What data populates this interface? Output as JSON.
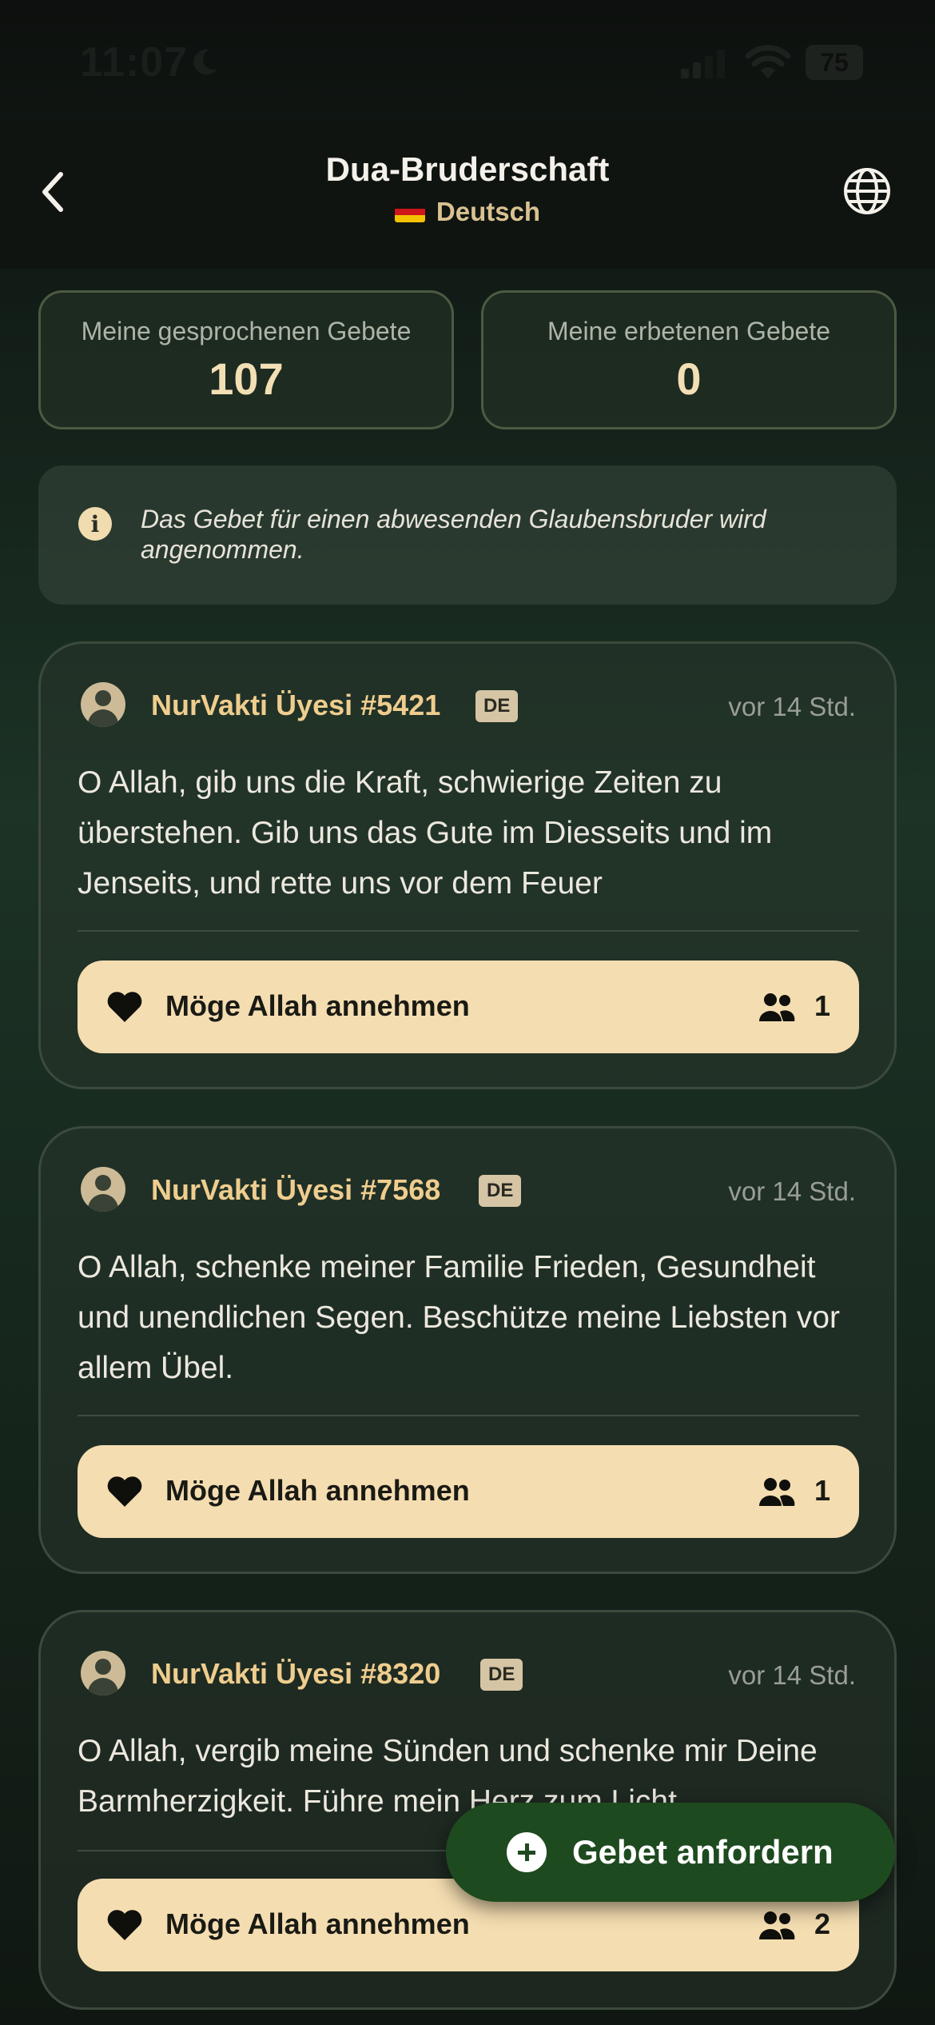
{
  "status_bar": {
    "time": "11:07",
    "battery": "75",
    "icons": [
      "moon-icon",
      "signal-icon",
      "wifi-icon",
      "battery-icon"
    ]
  },
  "header": {
    "title": "Dua-Bruderschaft",
    "language": "Deutsch",
    "icons": [
      "back-chevron-icon",
      "globe-icon",
      "german-flag-icon"
    ]
  },
  "stats": {
    "spoken": {
      "label": "Meine gesprochenen Gebete",
      "value": "107"
    },
    "requested": {
      "label": "Meine erbetenen Gebete",
      "value": "0"
    }
  },
  "info": {
    "icon": "info-icon",
    "text": "Das Gebet für einen abwesenden Glaubensbruder wird angenommen."
  },
  "posts": [
    {
      "user": "NurVakti Üyesi #5421",
      "lang_badge": "DE",
      "time": "vor 14 Std.",
      "text": "O Allah, gib uns die Kraft, schwierige Zeiten zu überstehen. Gib uns das Gute im Diesseits und im Jenseits, und rette uns vor dem Feuer",
      "button_label": "Möge Allah annehmen",
      "count": "1"
    },
    {
      "user": "NurVakti Üyesi #7568",
      "lang_badge": "DE",
      "time": "vor 14 Std.",
      "text": "O Allah, schenke meiner Familie Frieden, Gesundheit und unendlichen Segen. Beschütze meine Liebsten vor allem Übel.",
      "button_label": "Möge Allah annehmen",
      "count": "1"
    },
    {
      "user": "NurVakti Üyesi #8320",
      "lang_badge": "DE",
      "time": "vor 14 Std.",
      "text": "O Allah, vergib meine Sünden und schenke mir Deine Barmherzigkeit. Führe mein Herz zum Licht.",
      "button_label": "Möge Allah annehmen",
      "count": "2"
    }
  ],
  "fab": {
    "label": "Gebet anfordern",
    "icon": "plus-circle-icon"
  },
  "colors": {
    "accent": "#f4ddb1",
    "username": "#efcd8e",
    "fab": "#1e4a1f"
  }
}
